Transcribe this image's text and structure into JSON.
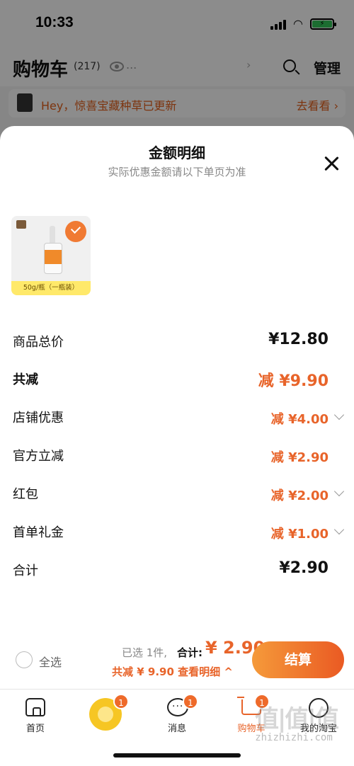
{
  "status_bar": {
    "time": "10:33",
    "battery": "⚡"
  },
  "cart_header": {
    "title": "购物车",
    "count": "(217)",
    "dots": "...",
    "chevron": "›",
    "manage_label": "管理"
  },
  "banner": {
    "text": "Hey，惊喜宝藏种草已更新",
    "link_label": "去看看 ›"
  },
  "sheet": {
    "title": "金额明细",
    "subtitle": "实际优惠金额请以下单页为准",
    "product": {
      "tag": "50g/瓶（一瓶装）",
      "selected": true
    },
    "rows": [
      {
        "label": "商品总价",
        "value": "¥12.80",
        "style": "total"
      },
      {
        "label": "共减",
        "value": "减 ¥9.90",
        "style": "discount-main"
      },
      {
        "label": "店铺优惠",
        "value": "减 ¥4.00",
        "style": "discount",
        "expandable": true
      },
      {
        "label": "官方立减",
        "value": "减 ¥2.90",
        "style": "discount",
        "expandable": false
      },
      {
        "label": "红包",
        "value": "减 ¥2.00",
        "style": "discount",
        "expandable": true
      },
      {
        "label": "首单礼金",
        "value": "减 ¥1.00",
        "style": "discount",
        "expandable": true
      },
      {
        "label": "合计",
        "value": "¥2.90",
        "style": "total"
      }
    ]
  },
  "settle_bar": {
    "select_all_label": "全选",
    "selected_info": "已选 1件,",
    "total_label": "合计:",
    "total_value": "¥ 2.90",
    "saved_info": "共减 ¥ 9.90  查看明细 ^",
    "checkout_label": "结算"
  },
  "tab_bar": {
    "tabs": [
      {
        "label": "首页",
        "icon": "home-icon"
      },
      {
        "label": "",
        "icon": "lion-icon",
        "badge": "1"
      },
      {
        "label": "消息",
        "icon": "chat-icon",
        "badge": "1"
      },
      {
        "label": "购物车",
        "icon": "cart-icon",
        "badge": "1",
        "active": true
      },
      {
        "label": "我的淘宝",
        "icon": "face-icon"
      }
    ]
  },
  "watermark": {
    "logo": "值|值|值",
    "text": "zhizhizhi.com"
  },
  "colors": {
    "accent": "#e8642a",
    "brand_gradient_start": "#f59a3a",
    "brand_gradient_end": "#ea5a23"
  }
}
